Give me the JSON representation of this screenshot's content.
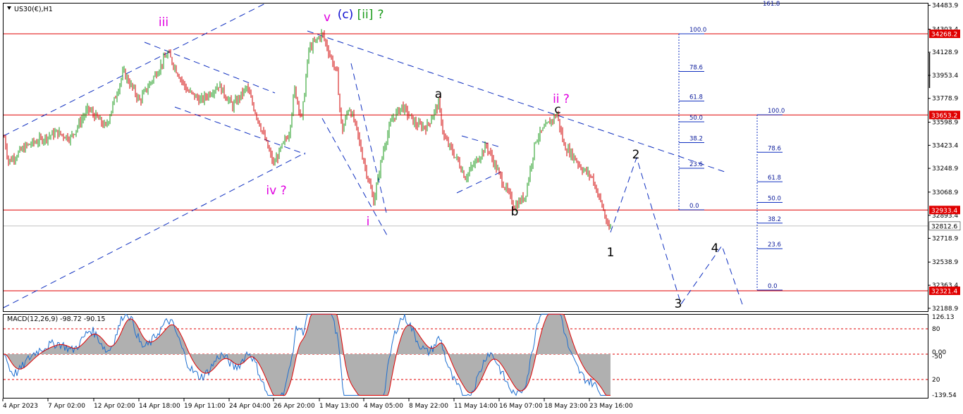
{
  "chart_data": {
    "type": "candlestick",
    "symbol_label": "US30(€),H1",
    "price_axis": {
      "ticks": [
        "34483.9",
        "34303.4",
        "34128.9",
        "33953.4",
        "33778.9",
        "33598.9",
        "33423.4",
        "33248.9",
        "33068.9",
        "32893.4",
        "32718.9",
        "32538.9",
        "32363.4",
        "32188.9"
      ],
      "ylim": [
        32160,
        34520
      ]
    },
    "time_axis": {
      "ticks": [
        "4 Apr 2023",
        "7 Apr 02:00",
        "12 Apr 02:00",
        "14 Apr 18:00",
        "19 Apr 11:00",
        "24 Apr 04:00",
        "26 Apr 20:00",
        "1 May 13:00",
        "4 May 05:00",
        "8 May 22:00",
        "11 May 14:00",
        "16 May 07:00",
        "18 May 23:00",
        "23 May 16:00"
      ]
    },
    "horizontal_levels": [
      {
        "price": 34268.2,
        "label": "34268.2",
        "color": "#e00000"
      },
      {
        "price": 33653.2,
        "label": "33653.2",
        "color": "#e00000"
      },
      {
        "price": 32933.4,
        "label": "32933.4",
        "color": "#e00000"
      },
      {
        "price": 32321.4,
        "label": "32321.4",
        "color": "#e00000"
      }
    ],
    "current_price": {
      "price": 32812.6,
      "label": "32812.6"
    },
    "price_path": [
      [
        33640,
        1
      ],
      [
        33300,
        12
      ],
      [
        33420,
        38
      ],
      [
        33520,
        80
      ],
      [
        33480,
        100
      ],
      [
        33700,
        125
      ],
      [
        33560,
        150
      ],
      [
        33980,
        175
      ],
      [
        33760,
        198
      ],
      [
        34120,
        238
      ],
      [
        33840,
        265
      ],
      [
        33760,
        285
      ],
      [
        33880,
        310
      ],
      [
        33720,
        330
      ],
      [
        33860,
        350
      ],
      [
        33560,
        370
      ],
      [
        33280,
        388
      ],
      [
        33520,
        410
      ],
      [
        33850,
        418
      ],
      [
        33620,
        428
      ],
      [
        34150,
        438
      ],
      [
        34270,
        457
      ],
      [
        34080,
        470
      ],
      [
        33960,
        478
      ],
      [
        33520,
        485
      ],
      [
        33720,
        495
      ],
      [
        33560,
        505
      ],
      [
        33390,
        512
      ],
      [
        33000,
        530
      ],
      [
        33420,
        545
      ],
      [
        33620,
        556
      ],
      [
        33720,
        570
      ],
      [
        33580,
        590
      ],
      [
        33560,
        605
      ],
      [
        33740,
        622
      ],
      [
        33480,
        630
      ],
      [
        33300,
        650
      ],
      [
        33180,
        660
      ],
      [
        33420,
        690
      ],
      [
        33120,
        715
      ],
      [
        32960,
        730
      ],
      [
        33040,
        745
      ],
      [
        33470,
        760
      ],
      [
        33600,
        780
      ],
      [
        33660,
        790
      ],
      [
        33420,
        800
      ],
      [
        33330,
        815
      ],
      [
        33250,
        825
      ],
      [
        33180,
        840
      ],
      [
        32950,
        855
      ],
      [
        32780,
        863
      ],
      [
        32812,
        867
      ]
    ],
    "macd": {
      "label": "MACD(12,26,9) -98.72 -90.15",
      "ticks": [
        "126.13",
        "80",
        "0.00",
        "-50",
        "20",
        "-139.54"
      ],
      "levels": [
        80,
        0,
        -80
      ]
    },
    "wave_labels": [
      {
        "text": "iii",
        "color": "#e000e0"
      },
      {
        "text": "v",
        "color": "#e000e0"
      },
      {
        "text": "(c)",
        "color": "#1010d0"
      },
      {
        "text": "[ii]",
        "color": "#1a9a1a"
      },
      {
        "text": "?",
        "color": "#1a9a1a"
      },
      {
        "text": "iv ?",
        "color": "#e000e0"
      },
      {
        "text": "i",
        "color": "#e000e0"
      },
      {
        "text": "a",
        "color": "#000000"
      },
      {
        "text": "b",
        "color": "#000000"
      },
      {
        "text": "c",
        "color": "#000000"
      },
      {
        "text": "ii ?",
        "color": "#e000e0"
      },
      {
        "text": "1",
        "color": "#000000"
      },
      {
        "text": "2",
        "color": "#000000"
      },
      {
        "text": "3",
        "color": "#000000"
      },
      {
        "text": "4",
        "color": "#000000"
      }
    ],
    "fib_set_1": [
      "100.0",
      "78.6",
      "61.8",
      "50.0",
      "38.2",
      "23.6",
      "0.0"
    ],
    "fib_set_2": [
      "100.0",
      "78.6",
      "61.8",
      "50.0",
      "38.2",
      "23.6",
      "0.0"
    ],
    "top_partial_label": "161.8",
    "colors": {
      "bull": "#1a9a1a",
      "bear": "#d00000",
      "level": "#e00000",
      "trend": "#1030c0",
      "macd_hist": "#b0b0b0",
      "macd_line": "#1e6fd0",
      "signal_line": "#e00000"
    }
  }
}
